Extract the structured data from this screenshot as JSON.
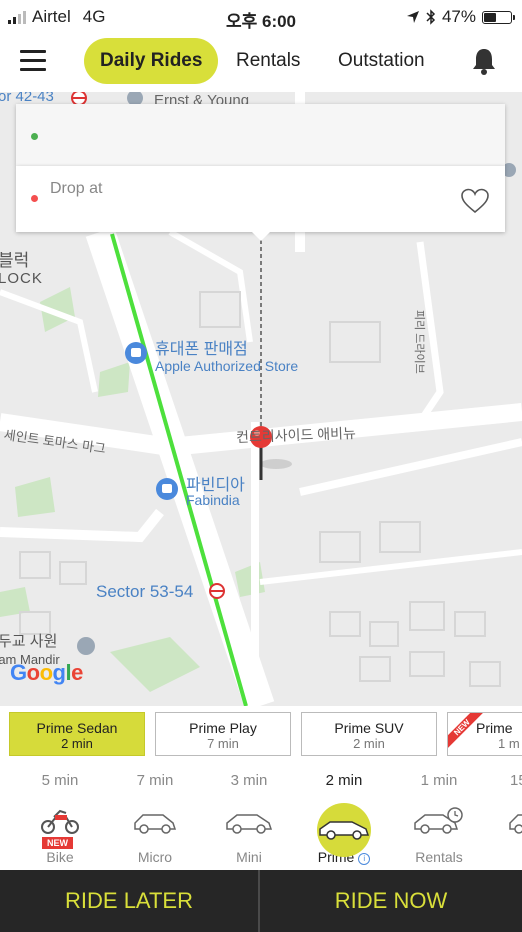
{
  "status_bar": {
    "carrier": "Airtel",
    "network": "4G",
    "time": "오후 6:00",
    "battery": "47%",
    "battery_level": 0.47
  },
  "nav": {
    "tabs": [
      {
        "label": "Daily Rides",
        "active": true
      },
      {
        "label": "Rentals",
        "active": false
      },
      {
        "label": "Outstation",
        "active": false
      }
    ],
    "accent_color": "#d8df3a"
  },
  "location": {
    "pickup_value": "",
    "drop_placeholder": "Drop at"
  },
  "map": {
    "labels": {
      "top_left": "or 42-43",
      "ernst": "Ernst & Young",
      "block_kr": "블럭",
      "block_en": "LOCK",
      "store_kr": "휴대폰 판매점",
      "store_en": "Apple Authorized Store",
      "road_left": "세인트 토마스 마그",
      "road_right": "컨트리사이드 애비뉴",
      "fab_kr": "파빈디아",
      "fab_en": "Fabindia",
      "sector": "Sector 53-54",
      "temple_kr": "두교 사원",
      "temple_en": "ram Mandir",
      "side_road": "피리 드라이브",
      "google": "Google"
    },
    "route_color": "#4de03c"
  },
  "categories": [
    {
      "name": "Prime Sedan",
      "eta": "2 min",
      "selected": true,
      "new": false
    },
    {
      "name": "Prime Play",
      "eta": "7 min",
      "selected": false,
      "new": false
    },
    {
      "name": "Prime SUV",
      "eta": "2 min",
      "selected": false,
      "new": false
    },
    {
      "name": "Prime",
      "eta": "1 m",
      "selected": false,
      "new": true,
      "new_label": "NEW"
    }
  ],
  "vehicles": [
    {
      "eta": "5 min",
      "label": "Bike",
      "icon": "bike-icon",
      "new_label": "NEW",
      "selected": false
    },
    {
      "eta": "7 min",
      "label": "Micro",
      "icon": "micro-car-icon",
      "selected": false
    },
    {
      "eta": "3 min",
      "label": "Mini",
      "icon": "mini-car-icon",
      "selected": false
    },
    {
      "eta": "2 min",
      "label": "Prime",
      "icon": "prime-car-icon",
      "selected": true,
      "info_icon": "i"
    },
    {
      "eta": "1 min",
      "label": "Rentals",
      "icon": "rentals-car-icon",
      "selected": false
    },
    {
      "eta": "15",
      "label": "",
      "icon": "car-icon",
      "selected": false
    }
  ],
  "actions": {
    "ride_later": "RIDE LATER",
    "ride_now": "RIDE NOW",
    "button_text_color": "#d9df3a"
  }
}
